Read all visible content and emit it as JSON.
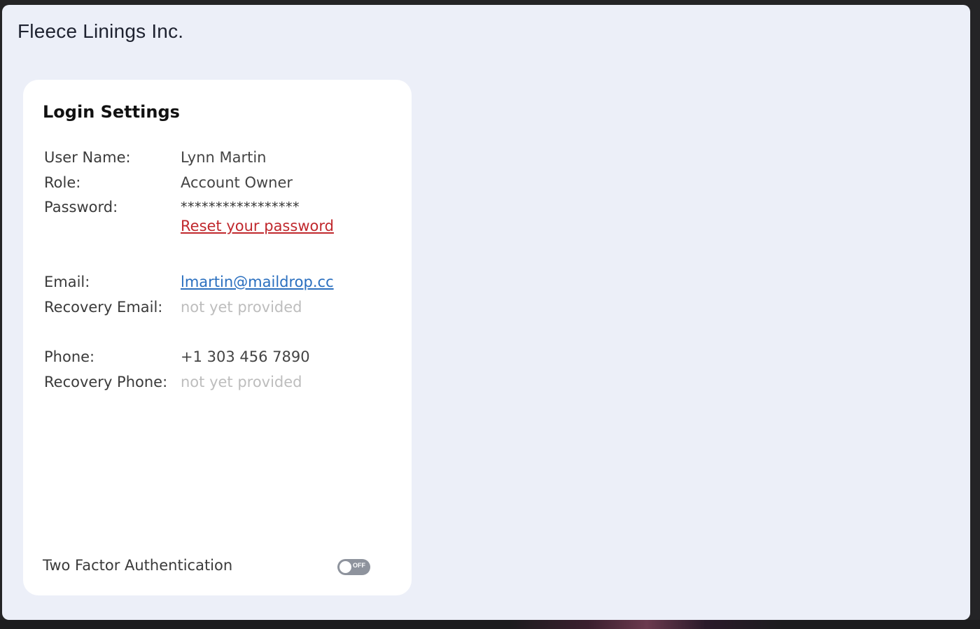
{
  "header": {
    "company_name": "Fleece Linings Inc."
  },
  "login_settings": {
    "title": "Login Settings",
    "user_name": {
      "label": "User Name:",
      "value": "Lynn Martin"
    },
    "role": {
      "label": "Role:",
      "value": "Account Owner"
    },
    "password": {
      "label": "Password:",
      "value": "*****************",
      "reset_link": "Reset your password"
    },
    "email": {
      "label": "Email:",
      "value": "lmartin@maildrop.cc"
    },
    "recovery_email": {
      "label": "Recovery Email:",
      "value": "not yet provided"
    },
    "phone": {
      "label": "Phone:",
      "value": "+1 303 456 7890"
    },
    "recovery_phone": {
      "label": "Recovery Phone:",
      "value": "not yet provided"
    },
    "two_factor": {
      "label": "Two Factor Authentication",
      "state_label": "OFF",
      "enabled": false
    }
  },
  "colors": {
    "page_background": "#eceff8",
    "card_background": "#ffffff",
    "reset_link": "#c0282d",
    "email_link": "#2a6fbf",
    "placeholder_text": "#bdbdbd",
    "toggle_off": "#8e939d"
  }
}
